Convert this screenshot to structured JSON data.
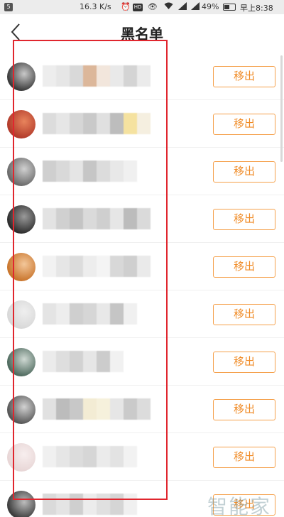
{
  "status_bar": {
    "notification_badge": "5",
    "network_speed": "16.3 K/s",
    "icons": [
      "alarm-icon",
      "hd-icon",
      "eye-icon",
      "wifi-icon",
      "signal-icon",
      "signal-icon"
    ],
    "hd_label": "HD",
    "battery_percent": "49%",
    "time": "早上8:38"
  },
  "header": {
    "title": "黑名单",
    "back_icon": "chevron-left-icon"
  },
  "blacklist": {
    "remove_label": "移出",
    "accent_color": "#f08a24",
    "items": [
      {
        "avatar": [
          "#3a3a3a",
          "#c9c9c9"
        ],
        "name_pixels": [
          "#ededed",
          "#e6e6e6",
          "#d9d9d9",
          "#dcb79a",
          "#f2e6dc",
          "#e9e9e9",
          "#d4d4d4",
          "#ebebeb"
        ]
      },
      {
        "avatar": [
          "#b23a2a",
          "#e8845c"
        ],
        "name_pixels": [
          "#dcdcdc",
          "#e6e6e6",
          "#d6d6d6",
          "#c9c9c9",
          "#e0e0e0",
          "#bdbdbd",
          "#f5e2a0",
          "#f5efe0"
        ]
      },
      {
        "avatar": [
          "#6a6a6a",
          "#d0d0d0"
        ],
        "name_pixels": [
          "#cfcfcf",
          "#d9d9d9",
          "#e5e5e5",
          "#c6c6c6",
          "#dcdcdc",
          "#e8e8e8",
          "#f0f0f0",
          "#ffffff"
        ]
      },
      {
        "avatar": [
          "#2d2d2d",
          "#9a9a9a"
        ],
        "name_pixels": [
          "#e3e3e3",
          "#d0d0d0",
          "#c4c4c4",
          "#dadada",
          "#cfcfcf",
          "#e6e6e6",
          "#bcbcbc",
          "#dadada"
        ]
      },
      {
        "avatar": [
          "#c9752c",
          "#f3c79a"
        ],
        "name_pixels": [
          "#f2f2f2",
          "#e6e6e6",
          "#dcdcdc",
          "#ededed",
          "#f4f4f4",
          "#d8d8d8",
          "#cfcfcf",
          "#eaeaea"
        ]
      },
      {
        "avatar": [
          "#d8d8d8",
          "#efefef"
        ],
        "name_pixels": [
          "#e4e4e4",
          "#ededed",
          "#cfcfcf",
          "#d6d6d6",
          "#e8e8e8",
          "#c5c5c5",
          "#f0f0f0",
          "#ffffff"
        ]
      },
      {
        "avatar": [
          "#4e6a5e",
          "#cfd9d3"
        ],
        "name_pixels": [
          "#ebebeb",
          "#dedede",
          "#d2d2d2",
          "#e6e6e6",
          "#cccccc",
          "#f1f1f1",
          "#ffffff",
          "#ffffff"
        ]
      },
      {
        "avatar": [
          "#565656",
          "#d2d2d2"
        ],
        "name_pixels": [
          "#e1e1e1",
          "#bcbcbc",
          "#c8c8c8",
          "#f3ecd4",
          "#f6f1dc",
          "#e6e6e6",
          "#cacaca",
          "#dcdcdc"
        ]
      },
      {
        "avatar": [
          "#e8d6d6",
          "#f7eeee"
        ],
        "name_pixels": [
          "#f0f0f0",
          "#e6e6e6",
          "#dcdcdc",
          "#d6d6d6",
          "#ebebeb",
          "#e3e3e3",
          "#f2f2f2",
          "#ffffff"
        ]
      },
      {
        "avatar": [
          "#3c3c3c",
          "#bdbdbd"
        ],
        "name_pixels": [
          "#dadada",
          "#e4e4e4",
          "#cfcfcf",
          "#ececec",
          "#e0e0e0",
          "#d5d5d5",
          "#f0f0f0",
          "#ffffff"
        ]
      }
    ]
  },
  "watermark": "智能家"
}
